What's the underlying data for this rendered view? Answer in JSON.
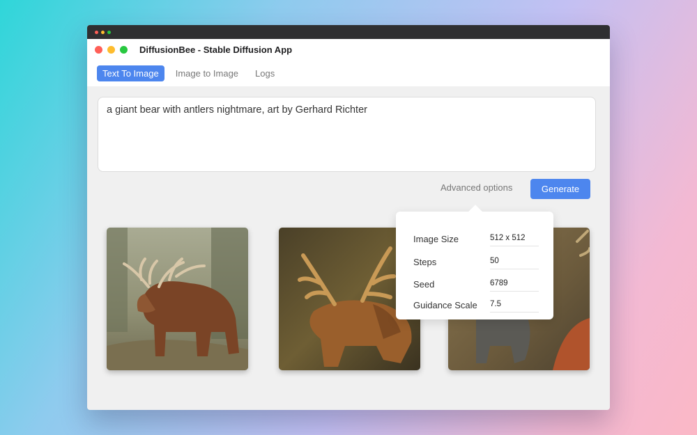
{
  "window": {
    "title": "DiffusionBee - Stable Diffusion App"
  },
  "tabs": [
    {
      "label": "Text To Image",
      "active": true
    },
    {
      "label": "Image to Image",
      "active": false
    },
    {
      "label": "Logs",
      "active": false
    }
  ],
  "prompt": {
    "value": "a giant bear with antlers nightmare, art by Gerhard Richter"
  },
  "actions": {
    "advanced_label": "Advanced options",
    "generate_label": "Generate"
  },
  "advanced": {
    "image_size": {
      "label": "Image Size",
      "value": "512 x 512"
    },
    "steps": {
      "label": "Steps",
      "value": "50"
    },
    "seed": {
      "label": "Seed",
      "value": "6789"
    },
    "guidance": {
      "label": "Guidance Scale",
      "value": "7.5"
    }
  },
  "colors": {
    "accent": "#4d86ee",
    "traffic_red": "#ff5f57",
    "traffic_yellow": "#febc2e",
    "traffic_green": "#28c840"
  },
  "images": [
    {
      "subject": "bear-with-antlers-forest"
    },
    {
      "subject": "bear-with-antlers-dark"
    },
    {
      "subject": "bear-with-antlers-fire"
    }
  ]
}
